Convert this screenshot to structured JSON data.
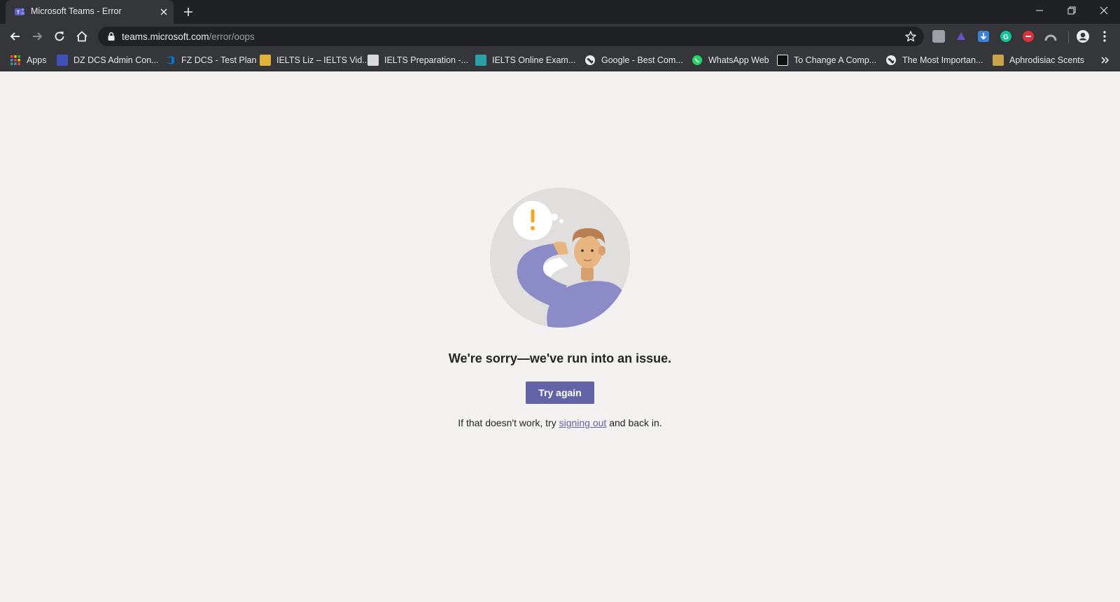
{
  "browser": {
    "tab": {
      "title": "Microsoft Teams - Error",
      "favicon": "teams-icon"
    },
    "address": {
      "host": "teams.microsoft.com",
      "path": "/error/oops"
    },
    "extensions": [
      "extension-icon",
      "extension-icon",
      "download-icon",
      "grammarly-icon",
      "extension-icon",
      "extension-icon"
    ],
    "bookmarks": [
      {
        "label": "Apps",
        "icon": "apps-grid-icon"
      },
      {
        "label": "DZ DCS Admin Con...",
        "icon": "bookmark-favicon"
      },
      {
        "label": "FZ DCS - Test Plan",
        "icon": "azure-devops-icon"
      },
      {
        "label": "IELTS Liz – IELTS Vid...",
        "icon": "bookmark-favicon"
      },
      {
        "label": "IELTS Preparation -...",
        "icon": "bookmark-favicon"
      },
      {
        "label": "IELTS Online Exam...",
        "icon": "bookmark-favicon"
      },
      {
        "label": "Google - Best Com...",
        "icon": "globe-icon"
      },
      {
        "label": "WhatsApp Web",
        "icon": "whatsapp-icon"
      },
      {
        "label": "To Change A Comp...",
        "icon": "bookmark-favicon"
      },
      {
        "label": "The Most Importan...",
        "icon": "globe-icon"
      },
      {
        "label": "Aphrodisiac Scents",
        "icon": "bookmark-favicon"
      }
    ]
  },
  "page": {
    "headline": "We're sorry—we've run into an issue.",
    "try_again": "Try again",
    "helper_before": "If that doesn't work, try ",
    "helper_link": "signing out",
    "helper_after": " and back in."
  },
  "colors": {
    "teams_purple": "#6264a7",
    "page_bg": "#f3f2f1",
    "chrome_dark": "#202124",
    "chrome_toolbar": "#35363a"
  }
}
